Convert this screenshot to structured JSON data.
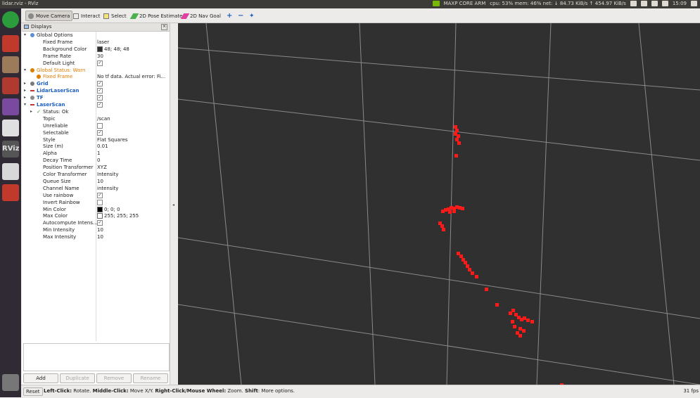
{
  "window": {
    "title": "lidar.rviz - RViz",
    "status_items": [
      "MAXP CORE ARM",
      "cpu: 53% mem: 46% net: ↓ 84.73 KiB/s ↑ 454.97 KiB/s",
      "15:09"
    ]
  },
  "toolbar": {
    "tools": [
      {
        "label": "Move Camera",
        "icon": "move-camera-icon",
        "active": true
      },
      {
        "label": "Interact",
        "icon": "interact-icon",
        "active": false
      },
      {
        "label": "Select",
        "icon": "select-icon",
        "active": false
      },
      {
        "label": "2D Pose Estimate",
        "icon": "pose-estimate-icon",
        "active": false
      },
      {
        "label": "2D Nav Goal",
        "icon": "nav-goal-icon",
        "active": false
      }
    ]
  },
  "displays": {
    "title": "Displays",
    "rows": [
      {
        "name": "Global Options",
        "value": "",
        "indent": 0,
        "arrow": "▾",
        "style": "",
        "check": ""
      },
      {
        "name": "Fixed Frame",
        "value": "laser",
        "indent": 2,
        "arrow": "",
        "style": "",
        "check": ""
      },
      {
        "name": "Background Color",
        "value": "48; 48; 48",
        "indent": 2,
        "arrow": "",
        "style": "",
        "check": "",
        "swatch": "#303030"
      },
      {
        "name": "Frame Rate",
        "value": "30",
        "indent": 2,
        "arrow": "",
        "style": "",
        "check": ""
      },
      {
        "name": "Default Light",
        "value": "",
        "indent": 2,
        "arrow": "",
        "style": "",
        "check": "✓"
      },
      {
        "name": "Global Status: Warn",
        "value": "",
        "indent": 0,
        "arrow": "▾",
        "style": "orange",
        "check": ""
      },
      {
        "name": "Fixed Frame",
        "value": "No tf data.  Actual error: Fi...",
        "indent": 1,
        "arrow": "",
        "style": "orange",
        "check": ""
      },
      {
        "name": "Grid",
        "value": "",
        "indent": 0,
        "arrow": "▸",
        "style": "blue",
        "check": "✓"
      },
      {
        "name": "LidarLaserScan",
        "value": "",
        "indent": 0,
        "arrow": "▸",
        "style": "blue",
        "check": "✓"
      },
      {
        "name": "TF",
        "value": "",
        "indent": 0,
        "arrow": "▸",
        "style": "blue",
        "check": "✓"
      },
      {
        "name": "LaserScan",
        "value": "",
        "indent": 0,
        "arrow": "▾",
        "style": "blue",
        "check": "✓"
      },
      {
        "name": "Status: Ok",
        "value": "",
        "indent": 1,
        "arrow": "▸",
        "style": "",
        "check": ""
      },
      {
        "name": "Topic",
        "value": "/scan",
        "indent": 2,
        "arrow": "",
        "style": "",
        "check": ""
      },
      {
        "name": "Unreliable",
        "value": "",
        "indent": 2,
        "arrow": "",
        "style": "",
        "check": " "
      },
      {
        "name": "Selectable",
        "value": "",
        "indent": 2,
        "arrow": "",
        "style": "",
        "check": "✓"
      },
      {
        "name": "Style",
        "value": "Flat Squares",
        "indent": 2,
        "arrow": "",
        "style": "",
        "check": ""
      },
      {
        "name": "Size (m)",
        "value": "0.01",
        "indent": 2,
        "arrow": "",
        "style": "",
        "check": ""
      },
      {
        "name": "Alpha",
        "value": "1",
        "indent": 2,
        "arrow": "",
        "style": "",
        "check": ""
      },
      {
        "name": "Decay Time",
        "value": "0",
        "indent": 2,
        "arrow": "",
        "style": "",
        "check": ""
      },
      {
        "name": "Position Transformer",
        "value": "XYZ",
        "indent": 2,
        "arrow": "",
        "style": "",
        "check": ""
      },
      {
        "name": "Color Transformer",
        "value": "Intensity",
        "indent": 2,
        "arrow": "",
        "style": "",
        "check": ""
      },
      {
        "name": "Queue Size",
        "value": "10",
        "indent": 2,
        "arrow": "",
        "style": "",
        "check": ""
      },
      {
        "name": "Channel Name",
        "value": "intensity",
        "indent": 2,
        "arrow": "",
        "style": "",
        "check": ""
      },
      {
        "name": "Use rainbow",
        "value": "",
        "indent": 2,
        "arrow": "",
        "style": "",
        "check": "✓"
      },
      {
        "name": "Invert Rainbow",
        "value": "",
        "indent": 2,
        "arrow": "",
        "style": "",
        "check": " "
      },
      {
        "name": "Min Color",
        "value": "0; 0; 0",
        "indent": 2,
        "arrow": "",
        "style": "",
        "check": "",
        "swatch": "#000000"
      },
      {
        "name": "Max Color",
        "value": "255; 255; 255",
        "indent": 2,
        "arrow": "",
        "style": "",
        "check": "",
        "swatch": "#ffffff"
      },
      {
        "name": "Autocompute Intens...",
        "value": "",
        "indent": 2,
        "arrow": "",
        "style": "",
        "check": "✓"
      },
      {
        "name": "Min Intensity",
        "value": "10",
        "indent": 2,
        "arrow": "",
        "style": "",
        "check": ""
      },
      {
        "name": "Max Intensity",
        "value": "10",
        "indent": 2,
        "arrow": "",
        "style": "",
        "check": ""
      }
    ],
    "buttons": [
      {
        "label": "Add",
        "enabled": true
      },
      {
        "label": "Duplicate",
        "enabled": false
      },
      {
        "label": "Remove",
        "enabled": false
      },
      {
        "label": "Rename",
        "enabled": false
      }
    ]
  },
  "statusbar": {
    "reset_label": "Reset",
    "hint_parts": [
      {
        "text": "Left-Click:",
        "bold": true
      },
      {
        "text": " Rotate. ",
        "bold": false
      },
      {
        "text": "Middle-Click:",
        "bold": true
      },
      {
        "text": " Move X/Y. ",
        "bold": false
      },
      {
        "text": "Right-Click/Mouse Wheel:",
        "bold": true
      },
      {
        "text": " Zoom. ",
        "bold": false
      },
      {
        "text": "Shift",
        "bold": true
      },
      {
        "text": ": More options.",
        "bold": false
      }
    ],
    "fps": "31 fps"
  },
  "colors": {
    "scan_point": "#ff1a1a",
    "grid_line": "#8a8a8a",
    "accent_blue": "#1b5fbf",
    "warn_orange": "#e07b00"
  }
}
